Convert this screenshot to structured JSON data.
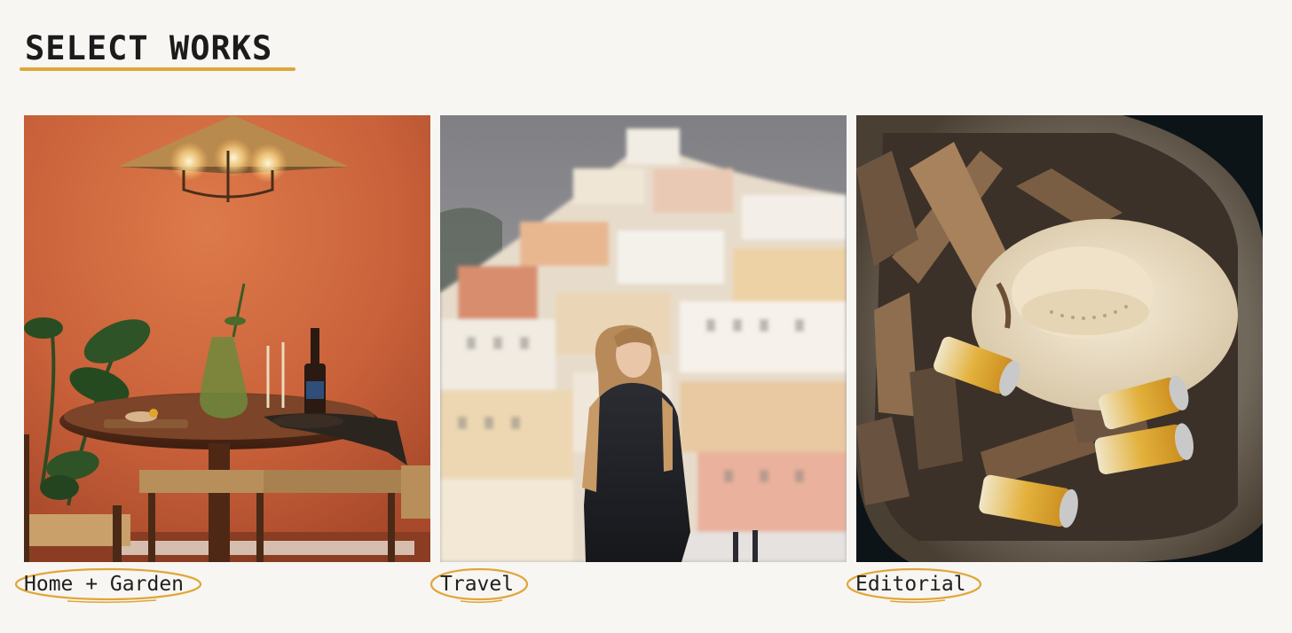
{
  "header": {
    "title": "SELECT WORKS"
  },
  "works": [
    {
      "label": "Home + Garden",
      "image": "home-garden-photo"
    },
    {
      "label": "Travel",
      "image": "travel-photo"
    },
    {
      "label": "Editorial",
      "image": "editorial-photo"
    }
  ],
  "colors": {
    "background": "#f8f6f3",
    "accent": "#e0a63a",
    "text": "#1b1b1b"
  }
}
